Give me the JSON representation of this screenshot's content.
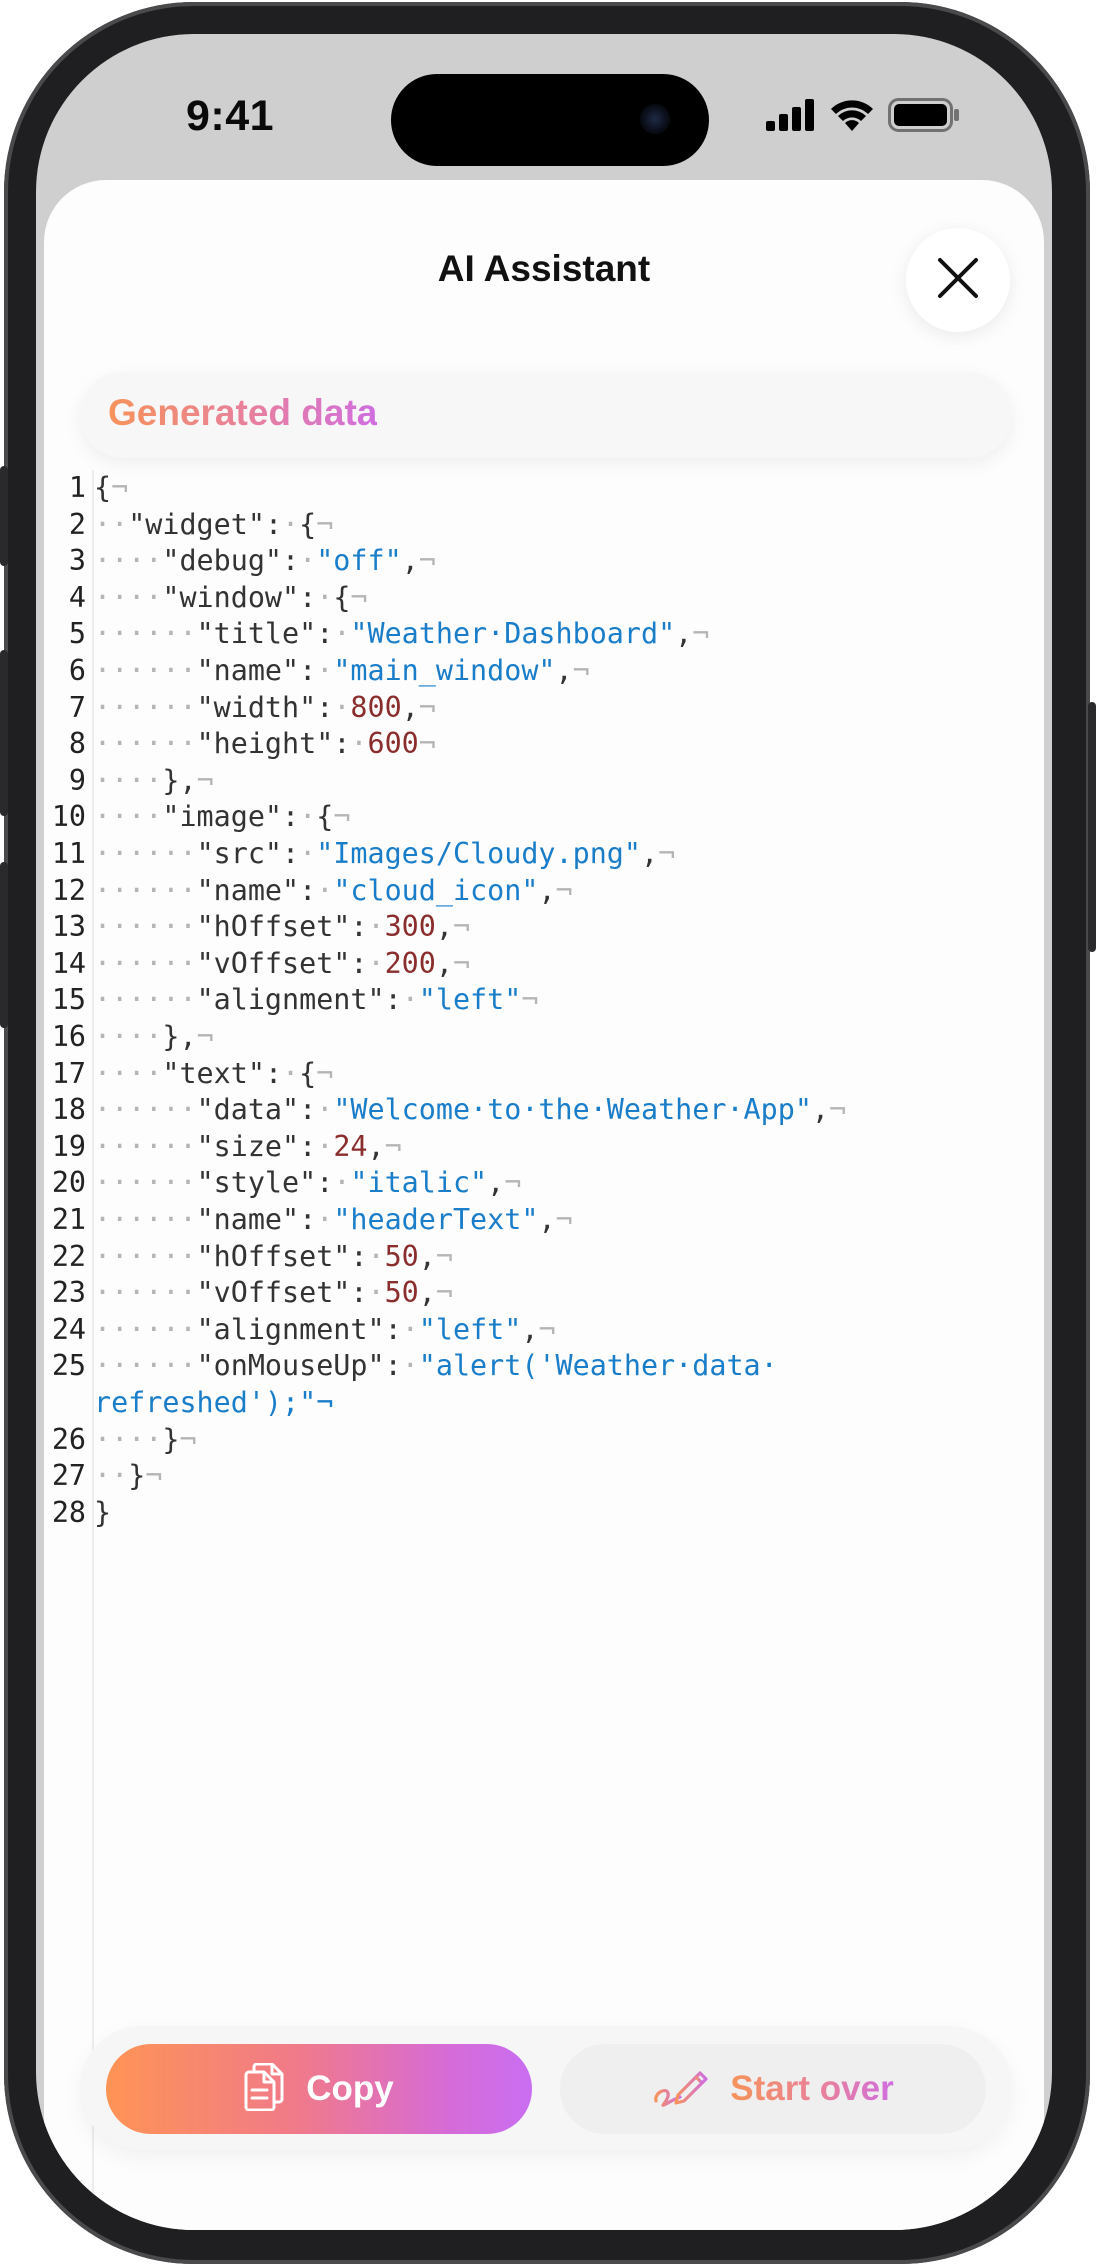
{
  "status_bar": {
    "time": "9:41"
  },
  "sheet": {
    "title": "AI Assistant",
    "generated_label": "Generated data",
    "copy_label": "Copy",
    "start_over_label": "Start over"
  },
  "colors": {
    "accent_start": "#f6935a",
    "accent_mid": "#e77fa0",
    "accent_end": "#c96ef2",
    "string": "#1a7dc9",
    "number": "#8a2d2d"
  },
  "code": {
    "language": "json",
    "lines": [
      {
        "n": "1",
        "text": "{¬"
      },
      {
        "n": "2",
        "text": "··\"widget\":·{¬"
      },
      {
        "n": "3",
        "text": "····\"debug\":·\"off\",¬"
      },
      {
        "n": "4",
        "text": "····\"window\":·{¬"
      },
      {
        "n": "5",
        "text": "······\"title\":·\"Weather·Dashboard\",¬"
      },
      {
        "n": "6",
        "text": "······\"name\":·\"main_window\",¬"
      },
      {
        "n": "7",
        "text": "······\"width\":·800,¬"
      },
      {
        "n": "8",
        "text": "······\"height\":·600¬"
      },
      {
        "n": "9",
        "text": "····},¬"
      },
      {
        "n": "10",
        "text": "····\"image\":·{¬"
      },
      {
        "n": "11",
        "text": "······\"src\":·\"Images/Cloudy.png\",¬"
      },
      {
        "n": "12",
        "text": "······\"name\":·\"cloud_icon\",¬"
      },
      {
        "n": "13",
        "text": "······\"hOffset\":·300,¬"
      },
      {
        "n": "14",
        "text": "······\"vOffset\":·200,¬"
      },
      {
        "n": "15",
        "text": "······\"alignment\":·\"left\"¬"
      },
      {
        "n": "16",
        "text": "····},¬"
      },
      {
        "n": "17",
        "text": "····\"text\":·{¬"
      },
      {
        "n": "18",
        "text": "······\"data\":·\"Welcome·to·the·Weather·App\",¬"
      },
      {
        "n": "19",
        "text": "······\"size\":·24,¬"
      },
      {
        "n": "20",
        "text": "······\"style\":·\"italic\",¬"
      },
      {
        "n": "21",
        "text": "······\"name\":·\"headerText\",¬"
      },
      {
        "n": "22",
        "text": "······\"hOffset\":·50,¬"
      },
      {
        "n": "23",
        "text": "······\"vOffset\":·50,¬"
      },
      {
        "n": "24",
        "text": "······\"alignment\":·\"left\",¬"
      },
      {
        "n": "25",
        "text": "······\"onMouseUp\":·\"alert('Weather·data·"
      },
      {
        "n": "",
        "text": "refreshed');\"¬"
      },
      {
        "n": "26",
        "text": "····}¬"
      },
      {
        "n": "27",
        "text": "··}¬"
      },
      {
        "n": "28",
        "text": "}"
      }
    ]
  },
  "icons": {
    "close": "close-icon",
    "copy": "copy-icon",
    "start_over": "pen-scribble-icon",
    "signal": "cellular-signal-icon",
    "wifi": "wifi-icon",
    "battery": "battery-icon"
  }
}
